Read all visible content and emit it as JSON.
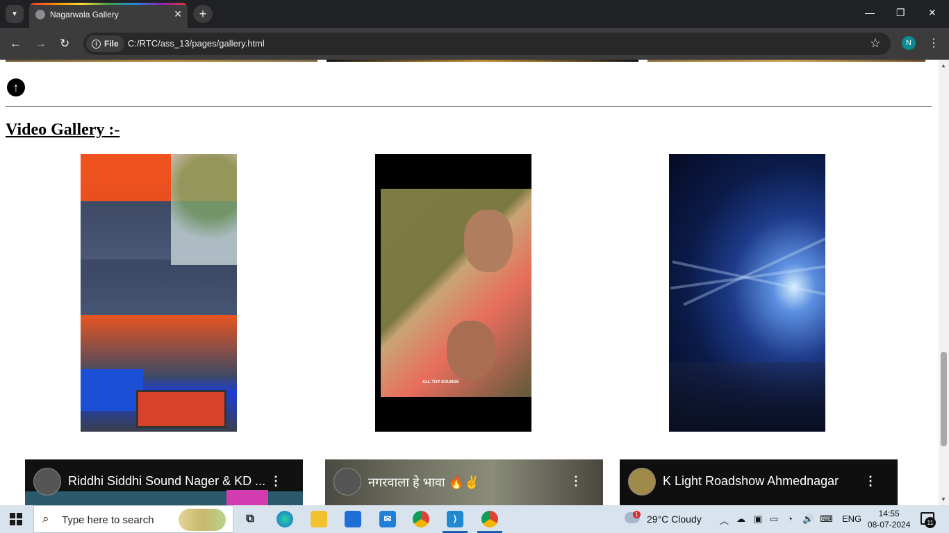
{
  "browser": {
    "tab_title": "Nagarwala Gallery",
    "tab_close": "✕",
    "new_tab": "+",
    "file_label": "File",
    "url": "C:/RTC/ass_13/pages/gallery.html",
    "profile_initial": "N"
  },
  "page": {
    "video_gallery_heading": "Video Gallery :-",
    "videos": [
      {
        "name": "speaker-stack-video"
      },
      {
        "name": "movie-clip-video",
        "watermark": "ALL TOP SOUNDS"
      },
      {
        "name": "laser-light-show-video"
      }
    ],
    "youtube_embeds": [
      {
        "title": "Riddhi Siddhi Sound Nager & KD ..."
      },
      {
        "title": "नगरवाला हे भावा 🔥✌"
      },
      {
        "title": "K Light Roadshow Ahmednagar"
      }
    ]
  },
  "taskbar": {
    "search_placeholder": "Type here to search",
    "weather": "29°C  Cloudy",
    "weather_badge": "1",
    "language": "ENG",
    "time": "14:55",
    "date": "08-07-2024",
    "notification_count": "11"
  }
}
